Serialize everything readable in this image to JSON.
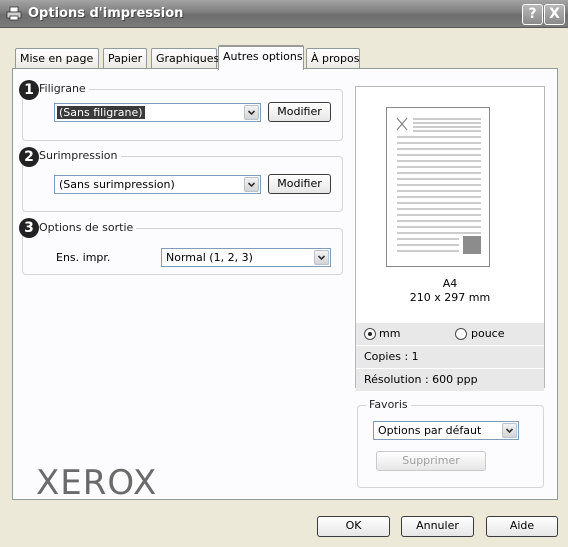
{
  "window": {
    "title": "Options d'impression",
    "help_glyph": "?",
    "close_glyph": "X"
  },
  "tabs": [
    {
      "label": "Mise en page"
    },
    {
      "label": "Papier"
    },
    {
      "label": "Graphiques"
    },
    {
      "label": "Autres options"
    },
    {
      "label": "À propos"
    }
  ],
  "active_tab": "Autres options",
  "watermark": {
    "badge": "1",
    "group_label": "Filigrane",
    "selected": "(Sans filigrane)",
    "modify_label": "Modifier"
  },
  "overlay": {
    "badge": "2",
    "group_label": "Surimpression",
    "selected": "(Sans surimpression)",
    "modify_label": "Modifier"
  },
  "output": {
    "badge": "3",
    "group_label": "Options de sortie",
    "field_label": "Ens. impr.",
    "selected": "Normal (1, 2, 3)"
  },
  "preview": {
    "paper_name": "A4",
    "paper_size": "210 x 297 mm",
    "unit_mm": "mm",
    "unit_inch": "pouce",
    "selected_unit": "mm",
    "copies": "Copies : 1",
    "resolution": "Résolution : 600 ppp"
  },
  "favorites": {
    "group_label": "Favoris",
    "selected": "Options par défaut",
    "delete_label": "Supprimer"
  },
  "brand": {
    "logo_text": "XEROX"
  },
  "footer": {
    "ok_label": "OK",
    "cancel_label": "Annuler",
    "help_label": "Aide"
  }
}
